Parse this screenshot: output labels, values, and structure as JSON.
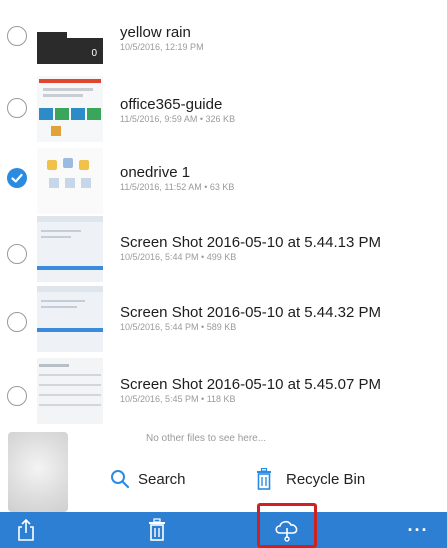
{
  "files": [
    {
      "name": "yellow rain",
      "meta": "10/5/2016, 12:19 PM",
      "thumb_label": "0",
      "selected": false
    },
    {
      "name": "office365-guide",
      "meta": "11/5/2016, 9:59 AM • 326 KB",
      "selected": false
    },
    {
      "name": "onedrive 1",
      "meta": "11/5/2016, 11:52 AM • 63 KB",
      "selected": true
    },
    {
      "name": "Screen Shot 2016-05-10 at 5.44.13 PM",
      "meta": "10/5/2016, 5:44 PM • 499 KB",
      "selected": false
    },
    {
      "name": "Screen Shot 2016-05-10 at 5.44.32 PM",
      "meta": "10/5/2016, 5:44 PM • 589 KB",
      "selected": false
    },
    {
      "name": "Screen Shot 2016-05-10 at 5.45.07 PM",
      "meta": "10/5/2016, 5:45 PM • 118 KB",
      "selected": false
    }
  ],
  "footer": {
    "no_more_text": "No other files to see here...",
    "search_label": "Search",
    "recycle_label": "Recycle Bin"
  },
  "toolbar": {
    "buttons": [
      "share-icon",
      "delete-icon",
      "download-icon",
      "more-icon"
    ],
    "more_label": "···",
    "color": "#2c7fd3"
  },
  "colors": {
    "accent": "#2a8be0",
    "highlight": "#d02121"
  }
}
